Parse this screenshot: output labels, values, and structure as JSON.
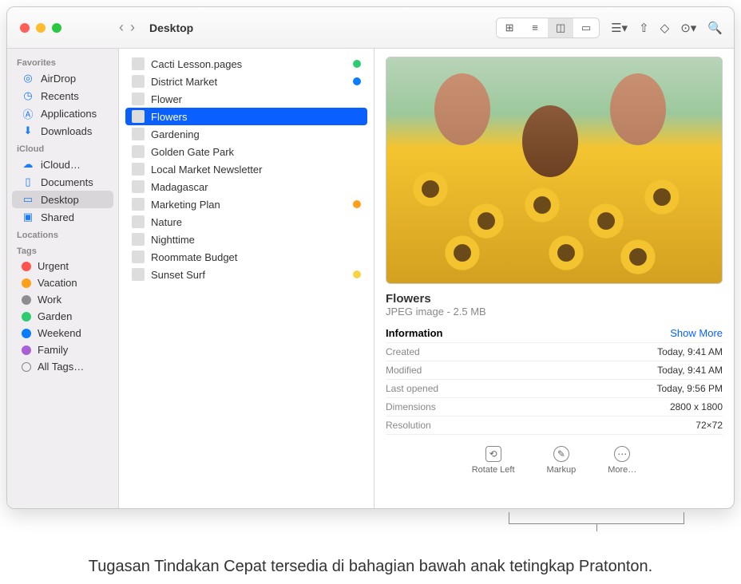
{
  "window_title": "Desktop",
  "sidebar": {
    "s1": {
      "head": "Favorites",
      "items": [
        "AirDrop",
        "Recents",
        "Applications",
        "Downloads"
      ]
    },
    "s2": {
      "head": "iCloud",
      "items": [
        "iCloud…",
        "Documents",
        "Desktop",
        "Shared"
      ]
    },
    "s3": {
      "head": "Locations"
    },
    "s4": {
      "head": "Tags",
      "items": [
        {
          "label": "Urgent",
          "color": "#ff5350"
        },
        {
          "label": "Vacation",
          "color": "#fea01a"
        },
        {
          "label": "Work",
          "color": "#8e8e92"
        },
        {
          "label": "Garden",
          "color": "#2ecc71"
        },
        {
          "label": "Weekend",
          "color": "#0a7cff"
        },
        {
          "label": "Family",
          "color": "#a960d6"
        },
        {
          "label": "All Tags…",
          "color": ""
        }
      ]
    }
  },
  "files": [
    {
      "name": "Cacti Lesson.pages",
      "tag": "#2ecc71"
    },
    {
      "name": "District Market",
      "tag": "#0a7cff"
    },
    {
      "name": "Flower",
      "tag": ""
    },
    {
      "name": "Flowers",
      "tag": "",
      "sel": true
    },
    {
      "name": "Gardening",
      "tag": ""
    },
    {
      "name": "Golden Gate Park",
      "tag": ""
    },
    {
      "name": "Local Market Newsletter",
      "tag": ""
    },
    {
      "name": "Madagascar",
      "tag": ""
    },
    {
      "name": "Marketing Plan",
      "tag": "#fea01a"
    },
    {
      "name": "Nature",
      "tag": ""
    },
    {
      "name": "Nighttime",
      "tag": ""
    },
    {
      "name": "Roommate Budget",
      "tag": ""
    },
    {
      "name": "Sunset Surf",
      "tag": "#f6d443"
    }
  ],
  "preview": {
    "title": "Flowers",
    "sub": "JPEG image - 2.5 MB",
    "info_head": "Information",
    "show_more": "Show More",
    "rows": [
      {
        "k": "Created",
        "v": "Today, 9:41 AM"
      },
      {
        "k": "Modified",
        "v": "Today, 9:41 AM"
      },
      {
        "k": "Last opened",
        "v": "Today, 9:56 PM"
      },
      {
        "k": "Dimensions",
        "v": "2800 x 1800"
      },
      {
        "k": "Resolution",
        "v": "72×72"
      }
    ],
    "actions": [
      "Rotate Left",
      "Markup",
      "More…"
    ]
  },
  "caption": "Tugasan Tindakan Cepat tersedia di bahagian bawah anak tetingkap Pratonton."
}
